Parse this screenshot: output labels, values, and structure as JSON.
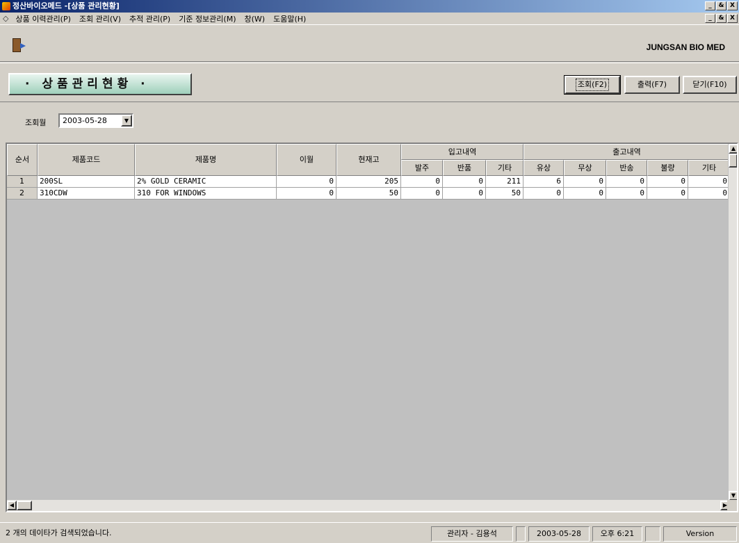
{
  "window": {
    "title": "정산바이오메드 -[상품 관리현황]",
    "controls": [
      "_",
      "&",
      "X"
    ]
  },
  "menu": {
    "items": [
      "상품 이력관리(P)",
      "조회 관리(V)",
      "추적 관리(P)",
      "기준 정보관리(M)",
      "창(W)",
      "도움말(H)"
    ]
  },
  "toolbar": {
    "exit_icon": "exit-door-icon",
    "brand": "JUNGSAN BIO MED"
  },
  "header": {
    "page_title": "· 상품관리현황 ·",
    "buttons": {
      "search": "조회(F2)",
      "print": "출력(F7)",
      "close": "닫기(F10)"
    }
  },
  "filter": {
    "label": "조회월",
    "date": "2003-05-28"
  },
  "table": {
    "columns": {
      "seq": "순서",
      "code": "제품코드",
      "name": "제품명",
      "carry": "이월",
      "stock": "현재고",
      "in_group": "입고내역",
      "in_order": "발주",
      "in_return": "반품",
      "in_etc": "기타",
      "out_group": "출고내역",
      "out_paid": "유상",
      "out_free": "무상",
      "out_return": "반송",
      "out_defect": "불량",
      "out_etc": "기타"
    },
    "rows": [
      {
        "seq": "1",
        "code": "200SL",
        "name": "2% GOLD CERAMIC",
        "carry": "0",
        "stock": "205",
        "in_order": "0",
        "in_return": "0",
        "in_etc": "211",
        "out_paid": "6",
        "out_free": "0",
        "out_return": "0",
        "out_defect": "0",
        "out_etc": "0"
      },
      {
        "seq": "2",
        "code": "310CDW",
        "name": "310 FOR WINDOWS",
        "carry": "0",
        "stock": "50",
        "in_order": "0",
        "in_return": "0",
        "in_etc": "50",
        "out_paid": "0",
        "out_free": "0",
        "out_return": "0",
        "out_defect": "0",
        "out_etc": "0"
      }
    ]
  },
  "status": {
    "message": "2 개의 데이타가 검색되었습니다.",
    "user": "관리자 - 김용석",
    "date": "2003-05-28",
    "time": "오후 6:21",
    "version": "Version"
  }
}
